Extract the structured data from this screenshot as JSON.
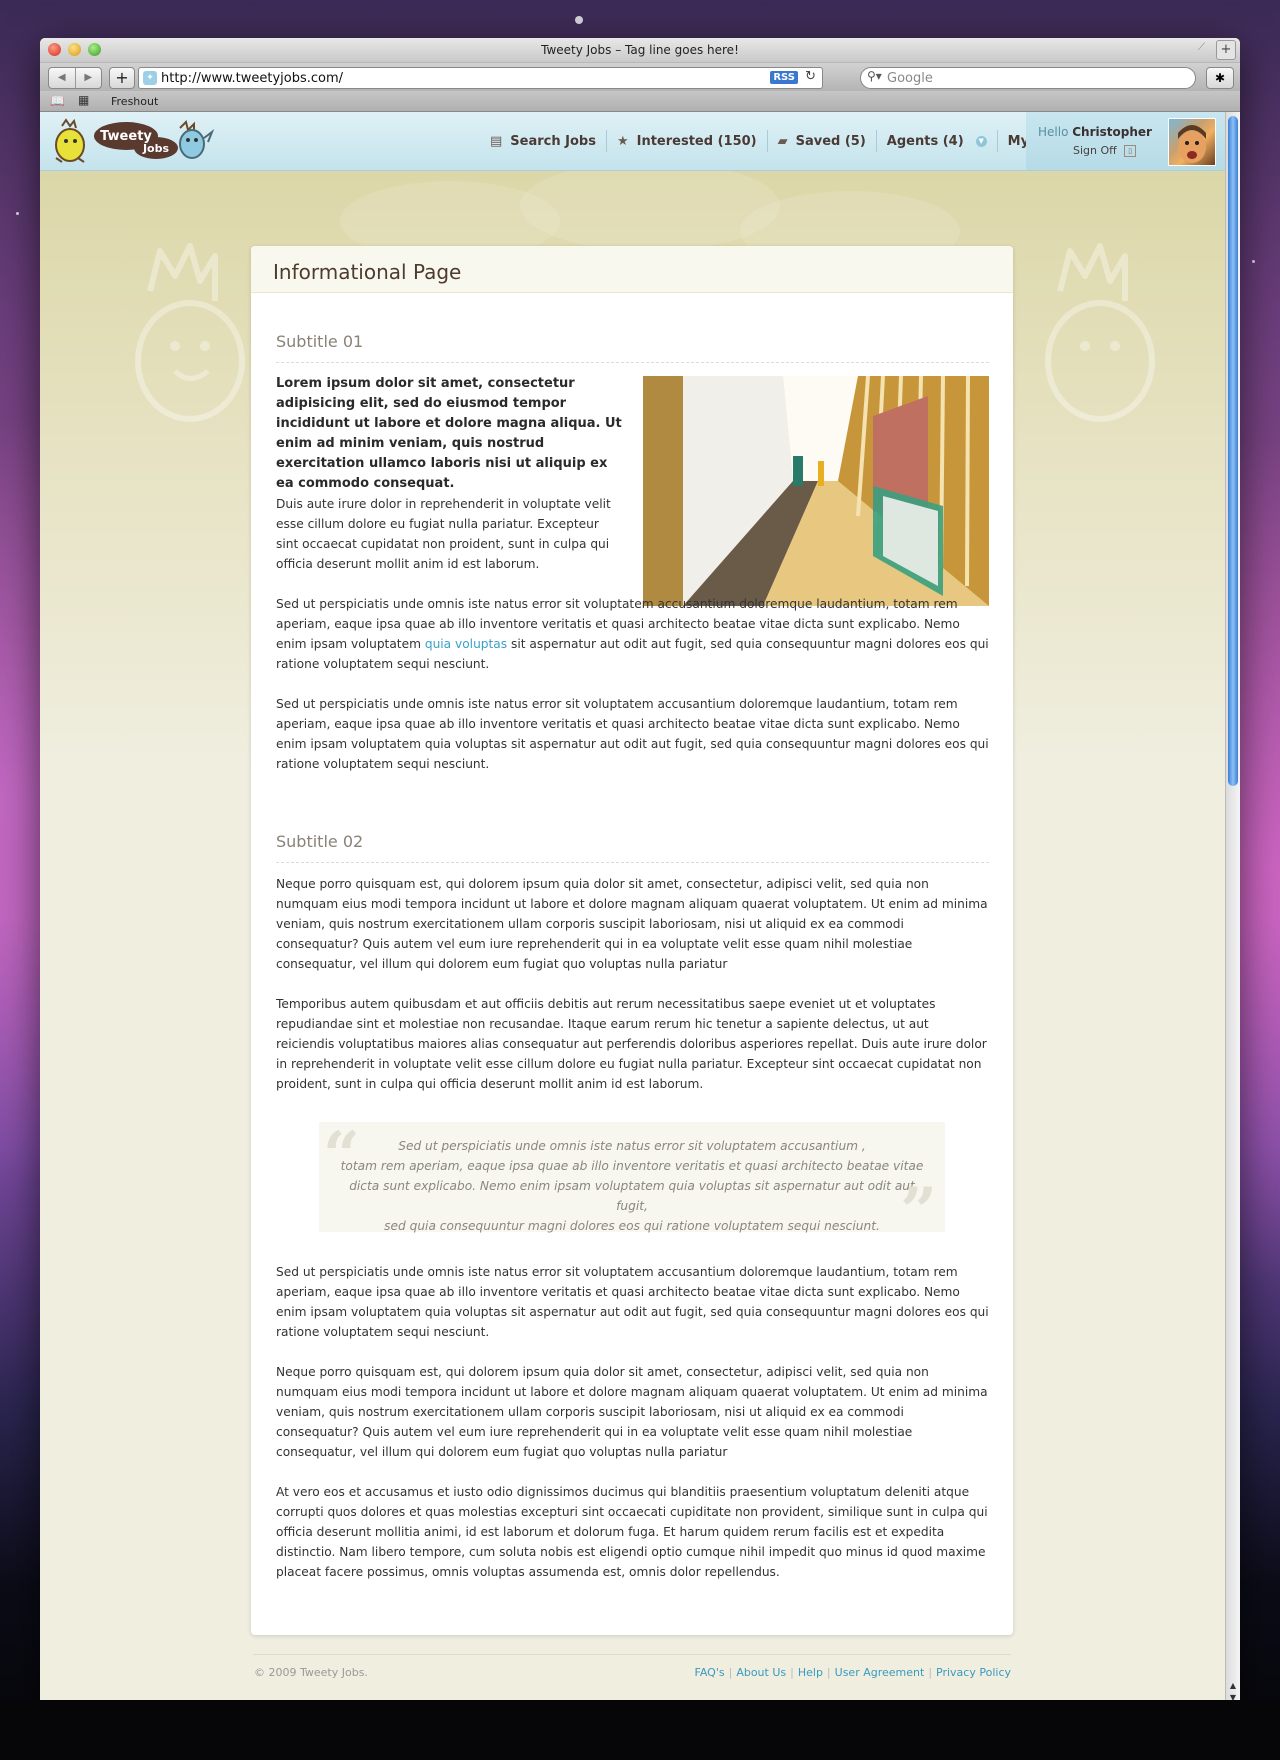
{
  "browser": {
    "window_title": "Tweety Jobs – Tag line goes here!",
    "url": "http://www.tweetyjobs.com/",
    "rss_label": "RSS",
    "search_placeholder": "Google",
    "bookmark": "Freshout"
  },
  "site": {
    "logo_text_1": "Tweety",
    "logo_text_2": "Jobs",
    "nav": [
      {
        "label": "Search Jobs",
        "icon": "newspaper-icon"
      },
      {
        "label": "Interested (150)",
        "icon": "star-icon"
      },
      {
        "label": "Saved (5)",
        "icon": "briefcase-icon"
      },
      {
        "label": "Agents (4)",
        "icon": "chevron-down-icon"
      },
      {
        "label": "My Stuff",
        "icon": "chevron-down-icon"
      }
    ],
    "user": {
      "hello": "Hello",
      "name": "Christopher",
      "sign_off": "Sign Off"
    }
  },
  "page": {
    "title": "Informational Page",
    "subtitle_1": "Subtitle 01",
    "lead": "Lorem ipsum dolor sit amet, consectetur adipisicing elit, sed do eiusmod tempor incididunt ut labore et dolore magna aliqua. Ut enim ad minim veniam, quis nostrud exercitation ullamco laboris nisi ut aliquip ex ea commodo consequat.",
    "p1": "Duis aute irure dolor in reprehenderit in voluptate velit esse cillum dolore eu fugiat nulla pariatur. Excepteur sint occaecat cupidatat non proident, sunt in culpa qui officia deserunt mollit anim id est laborum.",
    "p2_before": "Sed ut perspiciatis unde omnis iste natus error sit voluptatem accusantium doloremque laudantium, totam rem aperiam, eaque ipsa quae ab illo inventore veritatis et quasi architecto beatae vitae dicta sunt explicabo. Nemo enim ipsam voluptatem ",
    "p2_link": "quia voluptas",
    "p2_after": " sit aspernatur aut odit aut fugit, sed quia consequuntur magni dolores eos qui ratione voluptatem sequi nesciunt.",
    "p3": "Sed ut perspiciatis unde omnis iste natus error sit voluptatem accusantium doloremque laudantium, totam rem aperiam, eaque ipsa quae ab illo inventore veritatis et quasi architecto beatae vitae dicta sunt explicabo. Nemo enim ipsam voluptatem quia voluptas sit aspernatur aut odit aut fugit, sed quia consequuntur magni dolores eos qui ratione voluptatem sequi nesciunt.",
    "subtitle_2": "Subtitle 02",
    "p4": "Neque porro quisquam est, qui dolorem ipsum quia dolor sit amet, consectetur, adipisci velit, sed quia non numquam eius modi tempora incidunt ut labore et dolore magnam aliquam quaerat voluptatem. Ut enim ad minima veniam, quis nostrum exercitationem ullam corporis suscipit laboriosam, nisi ut aliquid ex ea commodi consequatur? Quis autem vel eum iure reprehenderit qui in ea voluptate velit esse quam nihil molestiae consequatur, vel illum qui dolorem eum fugiat quo voluptas nulla pariatur",
    "p5": "Temporibus autem quibusdam et aut officiis debitis aut rerum necessitatibus saepe eveniet ut et voluptates repudiandae sint et molestiae non recusandae. Itaque earum rerum hic tenetur a sapiente delectus, ut aut reiciendis voluptatibus maiores alias consequatur aut perferendis doloribus asperiores repellat.  Duis aute irure dolor in reprehenderit in voluptate velit esse cillum dolore eu fugiat nulla pariatur. Excepteur sint occaecat cupidatat non proident, sunt in culpa qui officia deserunt mollit anim id est laborum.",
    "quote_lines": [
      "Sed ut perspiciatis unde omnis iste natus error sit voluptatem accusantium ,",
      "totam rem aperiam, eaque ipsa quae ab illo inventore veritatis et quasi architecto beatae vitae",
      "dicta sunt explicabo. Nemo enim ipsam voluptatem quia voluptas sit aspernatur aut odit aut fugit,",
      "sed quia consequuntur magni dolores eos qui ratione voluptatem sequi nesciunt."
    ],
    "p6": "Sed ut perspiciatis unde omnis iste natus error sit voluptatem accusantium doloremque laudantium, totam rem aperiam, eaque ipsa quae ab illo inventore veritatis et quasi architecto beatae vitae dicta sunt explicabo. Nemo enim ipsam voluptatem quia voluptas sit aspernatur aut odit aut fugit, sed quia consequuntur magni dolores eos qui ratione voluptatem sequi nesciunt.",
    "p7": "Neque porro quisquam est, qui dolorem ipsum quia dolor sit amet, consectetur, adipisci velit, sed quia non numquam eius modi tempora incidunt ut labore et dolore magnam aliquam quaerat voluptatem. Ut enim ad minima veniam, quis nostrum exercitationem ullam corporis suscipit laboriosam, nisi ut aliquid ex ea commodi consequatur? Quis autem vel eum iure reprehenderit qui in ea voluptate velit esse quam nihil molestiae consequatur, vel illum qui dolorem eum fugiat quo voluptas nulla pariatur",
    "p8": "At vero eos et accusamus et iusto odio dignissimos ducimus qui blanditiis praesentium voluptatum deleniti atque corrupti quos dolores et quas molestias excepturi sint occaecati cupiditate non provident, similique sunt in culpa qui officia deserunt mollitia animi, id est laborum et dolorum fuga. Et harum quidem rerum facilis est et expedita distinctio. Nam libero tempore, cum soluta nobis est eligendi optio cumque nihil impedit quo minus id quod maxime placeat facere possimus, omnis voluptas assumenda est, omnis dolor repellendus."
  },
  "footer": {
    "copyright": "© 2009 Tweety Jobs.",
    "links": [
      "FAQ's",
      "About Us",
      "Help",
      "User Agreement",
      "Privacy Policy"
    ]
  },
  "colors": {
    "header_bg": "#c4e3ec",
    "page_bg": "#f0eedf",
    "link": "#3aa0c8",
    "title": "#4e3b30"
  }
}
